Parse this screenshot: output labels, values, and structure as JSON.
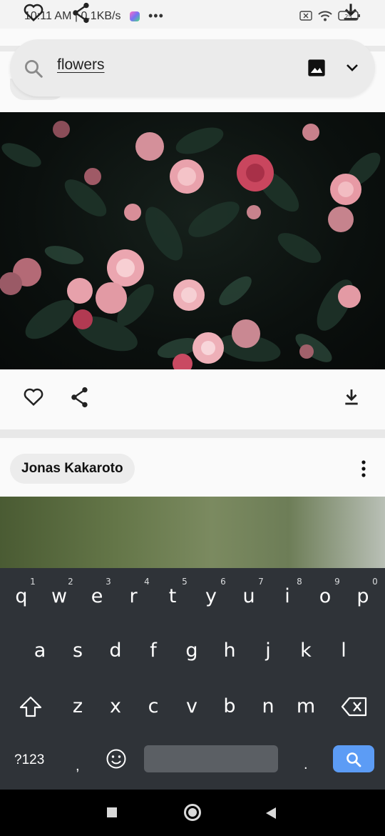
{
  "status_bar": {
    "time_speed": "10:11 AM | 0.1KB/s",
    "more": "•••",
    "battery_level": "25"
  },
  "search": {
    "query": "flowers"
  },
  "post": {
    "author": "Jonas Kakaroto"
  },
  "keyboard": {
    "row1": [
      {
        "key": "q",
        "hint": "1"
      },
      {
        "key": "w",
        "hint": "2"
      },
      {
        "key": "e",
        "hint": "3"
      },
      {
        "key": "r",
        "hint": "4"
      },
      {
        "key": "t",
        "hint": "5"
      },
      {
        "key": "y",
        "hint": "6"
      },
      {
        "key": "u",
        "hint": "7"
      },
      {
        "key": "i",
        "hint": "8"
      },
      {
        "key": "o",
        "hint": "9"
      },
      {
        "key": "p",
        "hint": "0"
      }
    ],
    "row2": [
      "a",
      "s",
      "d",
      "f",
      "g",
      "h",
      "j",
      "k",
      "l"
    ],
    "row3": [
      "z",
      "x",
      "c",
      "v",
      "b",
      "n",
      "m"
    ],
    "symbols_label": "?123",
    "comma": ",",
    "period": "."
  },
  "colors": {
    "keyboard_bg": "#2f3338",
    "search_key": "#5c9cf5",
    "page_bg": "#f3f3f3"
  }
}
